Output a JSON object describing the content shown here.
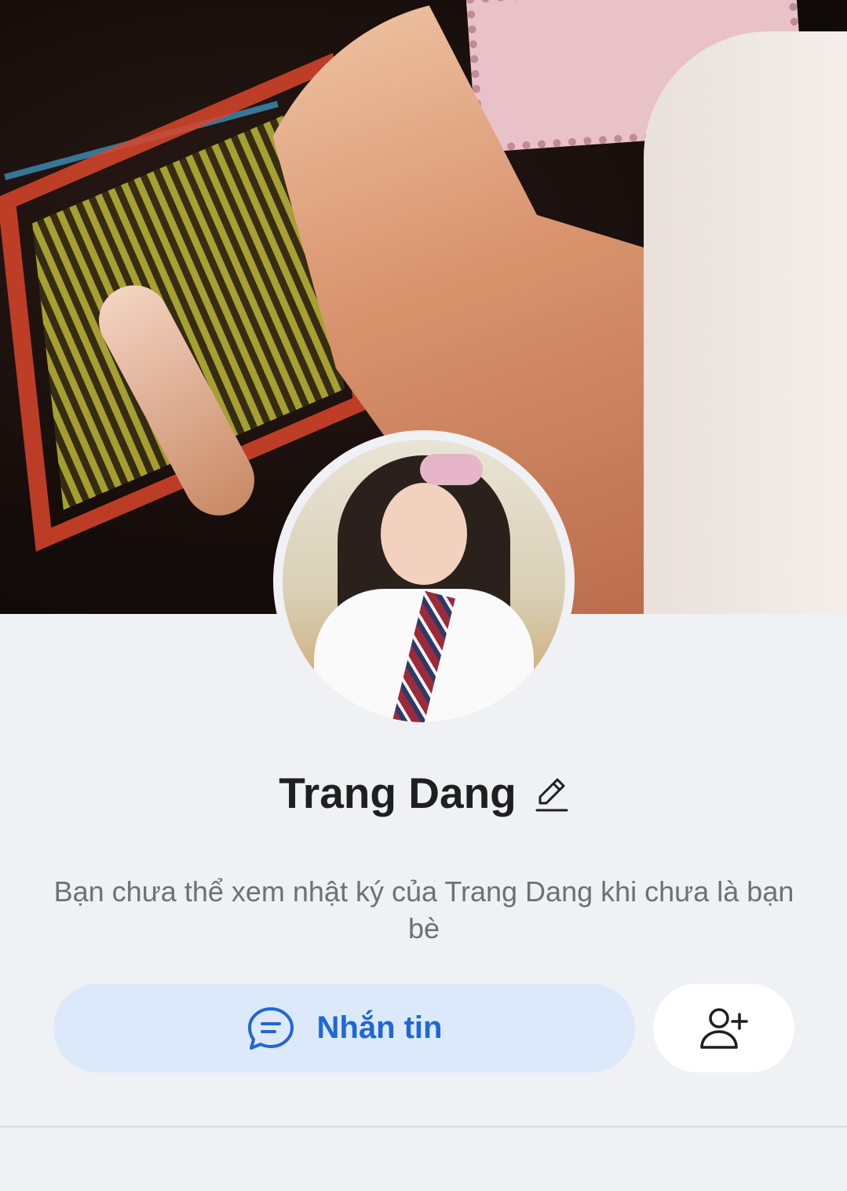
{
  "profile": {
    "name": "Trang Dang",
    "notice": "Bạn chưa thể xem nhật ký của Trang Dang khi chưa là bạn bè"
  },
  "actions": {
    "message_label": "Nhắn tin",
    "message_icon": "chat-bubble-icon",
    "add_friend_icon": "add-friend-icon",
    "edit_icon": "pencil-icon"
  },
  "colors": {
    "accent": "#1f67d6",
    "message_button_bg": "#dce9fb",
    "background": "#f0f1f5"
  }
}
